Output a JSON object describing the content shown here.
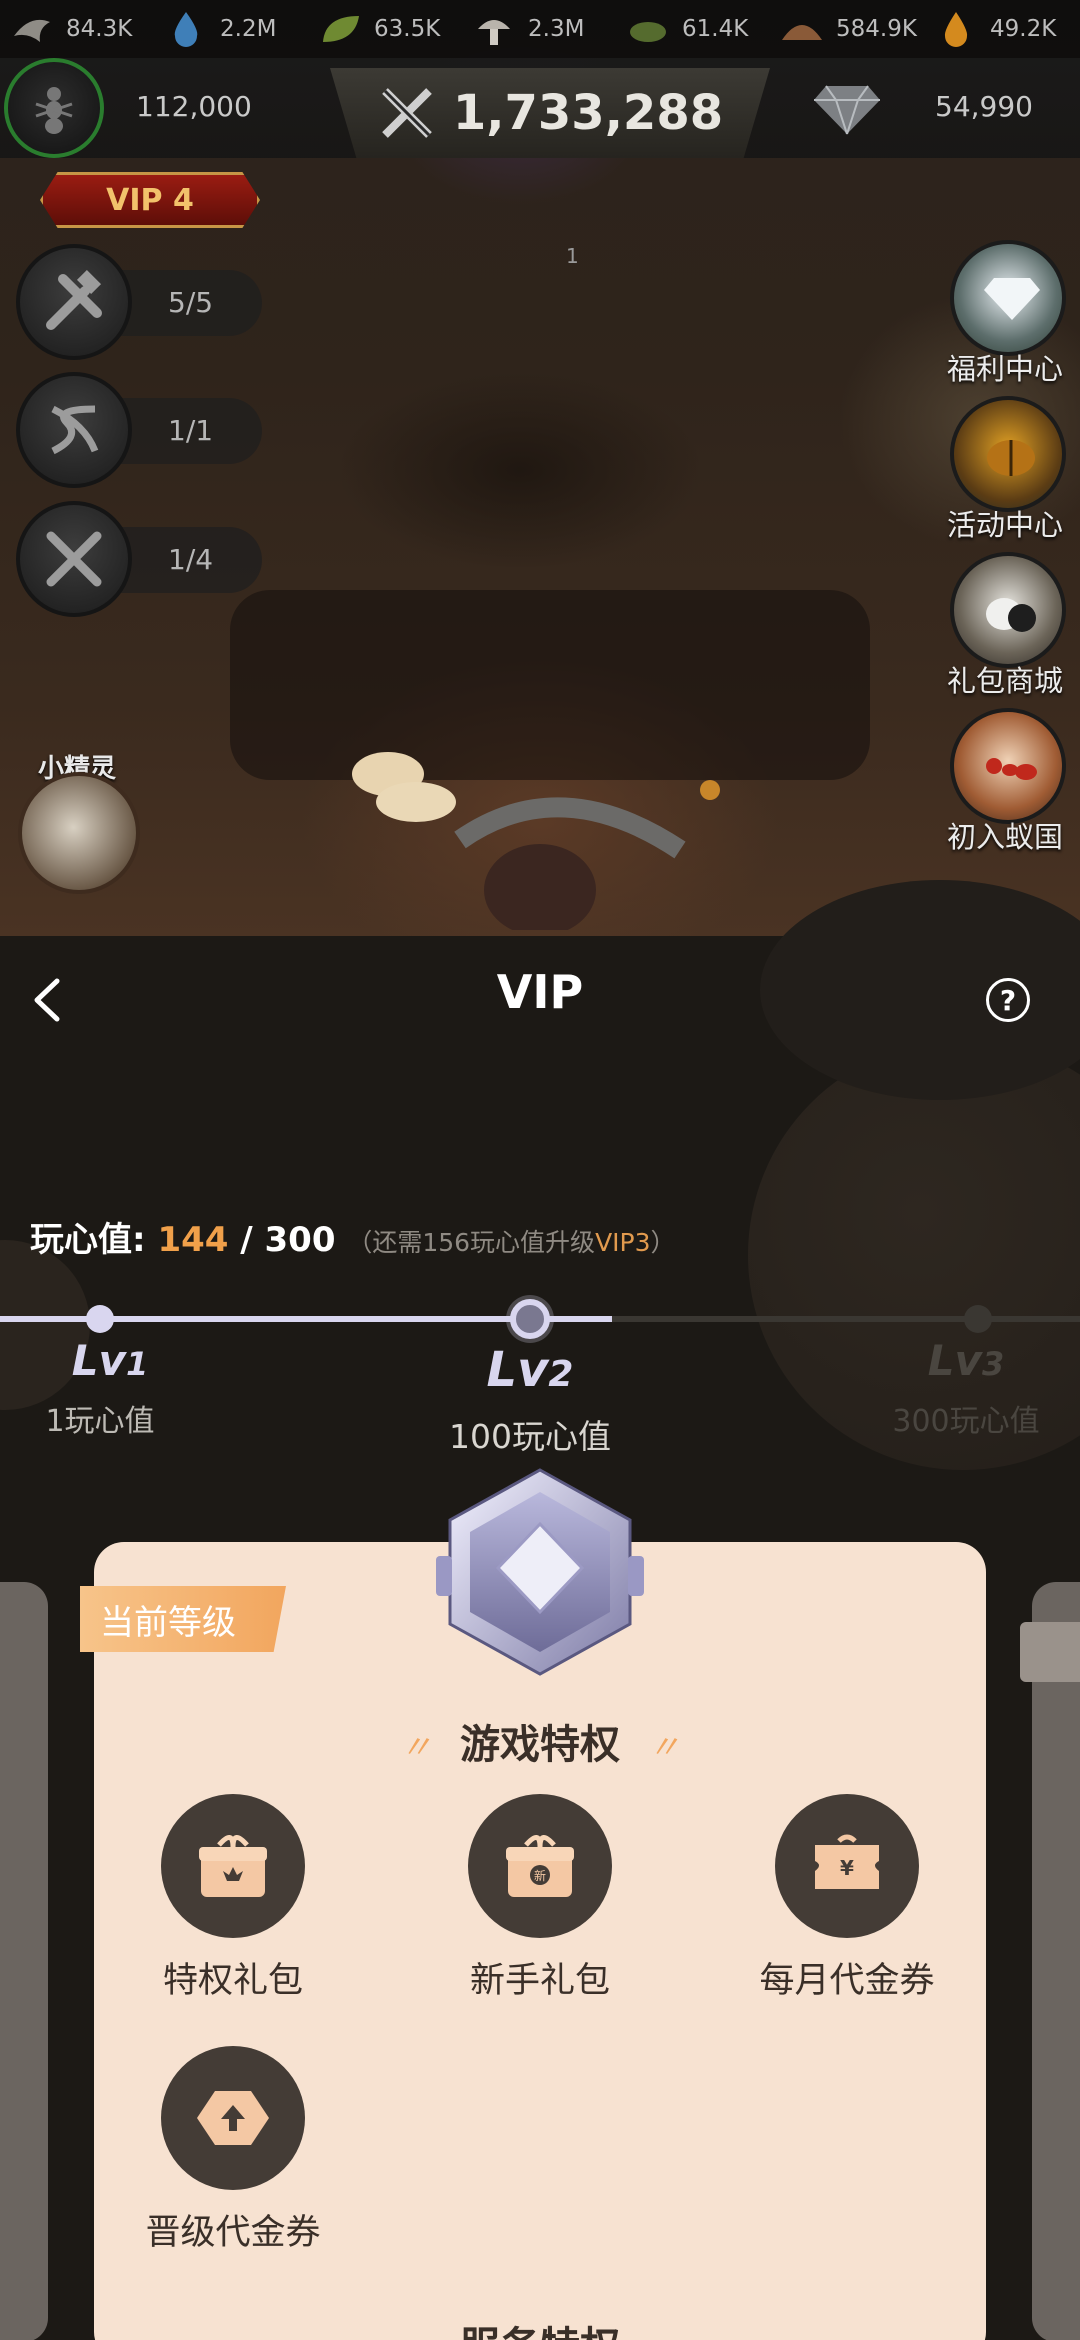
{
  "resources": [
    {
      "icon": "shrimp-icon",
      "value": "84.3K"
    },
    {
      "icon": "water-drop-icon",
      "value": "2.2M"
    },
    {
      "icon": "leaf-icon",
      "value": "63.5K"
    },
    {
      "icon": "mushroom-icon",
      "value": "2.3M"
    },
    {
      "icon": "plant-icon",
      "value": "61.4K"
    },
    {
      "icon": "soil-icon",
      "value": "584.9K"
    },
    {
      "icon": "honey-drop-icon",
      "value": "49.2K"
    }
  ],
  "player": {
    "power": "112,000",
    "might": "1,733,288",
    "diamonds": "54,990",
    "vip_label": "VIP 4"
  },
  "side_buttons": [
    {
      "icon": "build-tools-icon",
      "count": "5/5"
    },
    {
      "icon": "dna-icon",
      "count": "1/1"
    },
    {
      "icon": "crossed-swords-icon",
      "count": "1/4"
    }
  ],
  "map_marker": "1",
  "right_menu": [
    {
      "label": "福利中心",
      "icon": "diamond-icon"
    },
    {
      "label": "活动中心",
      "icon": "beetle-icon"
    },
    {
      "label": "礼包商城",
      "icon": "gift-shop-icon"
    },
    {
      "label": "初入蚁国",
      "icon": "ant-icon"
    }
  ],
  "sprite": {
    "label": "小精灵"
  },
  "vip": {
    "title": "VIP",
    "points_label": "玩心值: ",
    "points_current": "144",
    "points_sep": " / ",
    "points_target": "300",
    "hint_prefix": "（还需156玩心值升级",
    "hint_vip": "VIP3",
    "hint_suffix": "）",
    "levels": [
      {
        "lv": "Lv",
        "num": "1",
        "points": "1玩心值"
      },
      {
        "lv": "Lv",
        "num": "2",
        "points": "100玩心值"
      },
      {
        "lv": "Lv",
        "num": "3",
        "points": "300玩心值"
      }
    ],
    "current_tag": "当前等级",
    "section_game": "游戏特权",
    "section_service": "服务特权",
    "perks": [
      {
        "label": "特权礼包",
        "icon": "crown-gift-icon"
      },
      {
        "label": "新手礼包",
        "icon": "new-gift-icon"
      },
      {
        "label": "每月代金券",
        "icon": "yen-voucher-icon"
      },
      {
        "label": "晋级代金券",
        "icon": "upgrade-voucher-icon"
      }
    ]
  },
  "colors": {
    "accent_orange": "#f0a04a",
    "card_bg": "#f7e2d1",
    "panel_bg": "#1c1915",
    "progress": "#d9d6ef"
  }
}
